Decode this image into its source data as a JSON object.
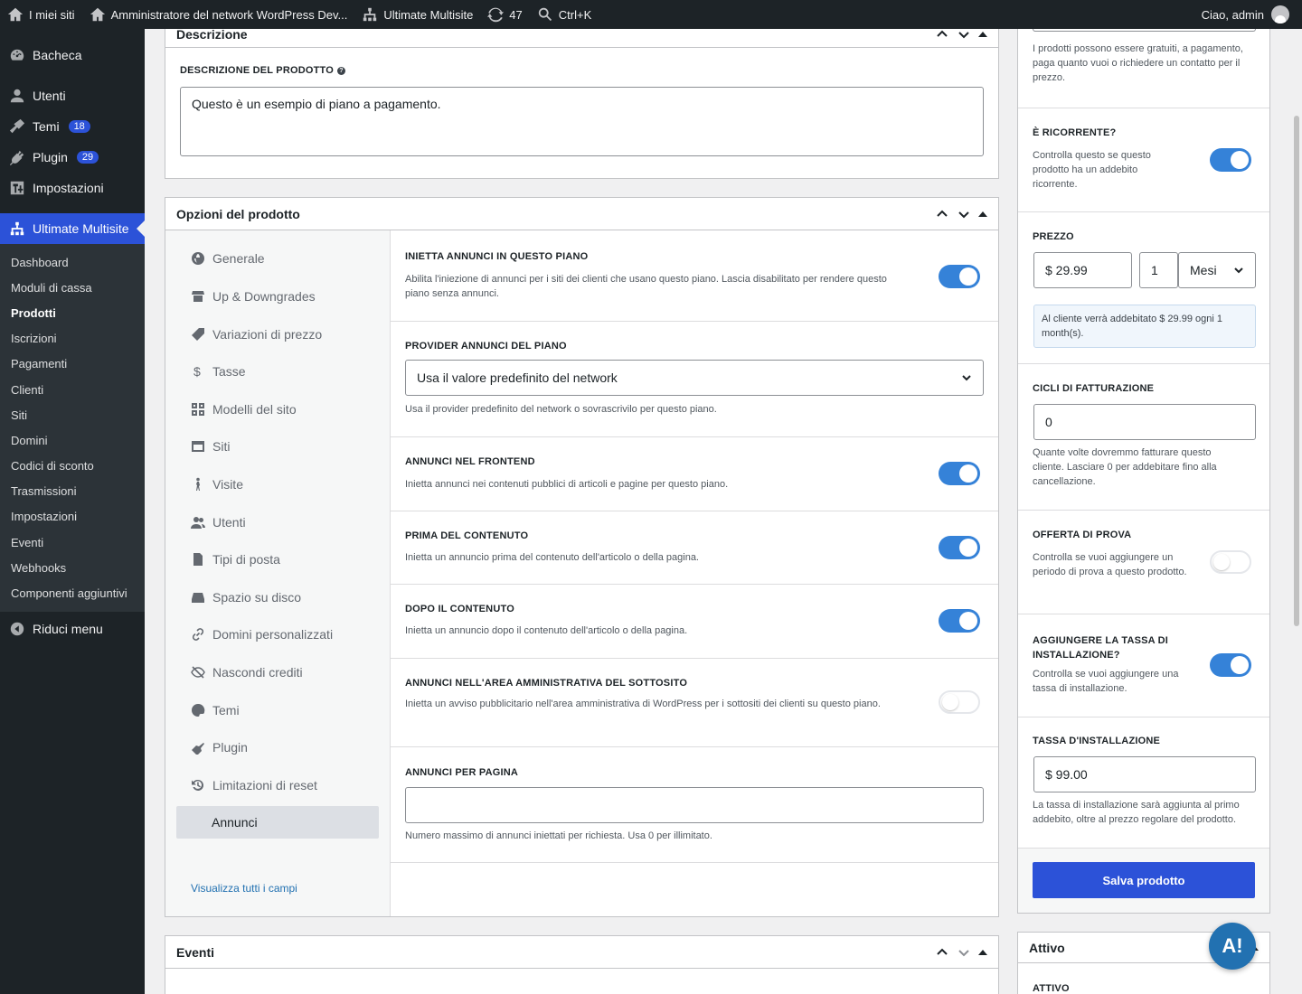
{
  "adminbar": {
    "my_sites": "I miei siti",
    "network_admin": "Amministratore del network WordPress Dev...",
    "ultimate_multisite": "Ultimate Multisite",
    "updates_count": "47",
    "search_shortcut": "Ctrl+K",
    "greeting": "Ciao, admin"
  },
  "sidebar": {
    "items": [
      {
        "label": "Bacheca",
        "icon": "dashboard-icon"
      },
      {
        "label": "Utenti",
        "icon": "users-icon"
      },
      {
        "label": "Temi",
        "icon": "themes-icon",
        "badge": "18"
      },
      {
        "label": "Plugin",
        "icon": "plugins-icon",
        "badge": "29"
      },
      {
        "label": "Impostazioni",
        "icon": "settings-icon"
      }
    ],
    "current": {
      "label": "Ultimate Multisite",
      "icon": "network-icon"
    },
    "submenu": [
      "Dashboard",
      "Moduli di cassa",
      "Prodotti",
      "Iscrizioni",
      "Pagamenti",
      "Clienti",
      "Siti",
      "Domini",
      "Codici di sconto",
      "Trasmissioni",
      "Impostazioni",
      "Eventi",
      "Webhooks",
      "Componenti aggiuntivi"
    ],
    "submenu_active": "Prodotti",
    "collapse": "Riduci menu"
  },
  "description_box": {
    "title": "Descrizione",
    "field_label": "DESCRIZIONE DEL PRODOTTO",
    "value": "Questo è un esempio di piano a pagamento."
  },
  "options_box": {
    "title": "Opzioni del prodotto",
    "nav": [
      {
        "label": "Generale",
        "icon": "globe-icon"
      },
      {
        "label": "Up & Downgrades",
        "icon": "store-icon"
      },
      {
        "label": "Variazioni di prezzo",
        "icon": "tag-icon"
      },
      {
        "label": "Tasse",
        "icon": "dollar-icon"
      },
      {
        "label": "Modelli del sito",
        "icon": "grid-icon"
      },
      {
        "label": "Siti",
        "icon": "browser-icon"
      },
      {
        "label": "Visite",
        "icon": "person-walk-icon"
      },
      {
        "label": "Utenti",
        "icon": "users-icon"
      },
      {
        "label": "Tipi di posta",
        "icon": "document-icon"
      },
      {
        "label": "Spazio su disco",
        "icon": "drive-icon"
      },
      {
        "label": "Domini personalizzati",
        "icon": "link-icon"
      },
      {
        "label": "Nascondi crediti",
        "icon": "eye-off-icon"
      },
      {
        "label": "Temi",
        "icon": "palette-icon"
      },
      {
        "label": "Plugin",
        "icon": "plug-icon"
      },
      {
        "label": "Limitazioni di reset",
        "icon": "history-icon"
      },
      {
        "label": "Annunci",
        "icon": ""
      }
    ],
    "view_all": "Visualizza tutti i campi",
    "rows": {
      "inject": {
        "label": "INIETTA ANNUNCI IN QUESTO PIANO",
        "desc": "Abilita l'iniezione di annunci per i siti dei clienti che usano questo piano. Lascia disabilitato per rendere questo piano senza annunci.",
        "on": true
      },
      "provider": {
        "label": "PROVIDER ANNUNCI DEL PIANO",
        "value": "Usa il valore predefinito del network",
        "desc": "Usa il provider predefinito del network o sovrascrivilo per questo piano."
      },
      "frontend": {
        "label": "ANNUNCI NEL FRONTEND",
        "desc": "Inietta annunci nei contenuti pubblici di articoli e pagine per questo piano.",
        "on": true
      },
      "before": {
        "label": "PRIMA DEL CONTENUTO",
        "desc": "Inietta un annuncio prima del contenuto dell'articolo o della pagina.",
        "on": true
      },
      "after": {
        "label": "DOPO IL CONTENUTO",
        "desc": "Inietta un annuncio dopo il contenuto dell'articolo o della pagina.",
        "on": true
      },
      "admin": {
        "label": "ANNUNCI NELL'AREA AMMINISTRATIVA DEL SOTTOSITO",
        "desc": "Inietta un avviso pubblicitario nell'area amministrativa di WordPress per i sottositi dei clienti su questo piano.",
        "on": false
      },
      "per_page": {
        "label": "ANNUNCI PER PAGINA",
        "value": "",
        "desc": "Numero massimo di annunci iniettati per richiesta. Usa 0 per illimitato."
      }
    }
  },
  "events_box": {
    "title": "Eventi"
  },
  "pricing": {
    "type_desc": "I prodotti possono essere gratuiti, a pagamento, paga quanto vuoi o richiedere un contatto per il prezzo.",
    "recurring": {
      "label": "È RICORRENTE?",
      "desc": "Controlla questo se questo prodotto ha un addebito ricorrente.",
      "on": true
    },
    "price": {
      "label": "PREZZO",
      "amount": "$ 29.99",
      "interval": "1",
      "unit": "Mesi",
      "note": "Al cliente verrà addebitato $ 29.99 ogni 1 month(s)."
    },
    "cycles": {
      "label": "CICLI DI FATTURAZIONE",
      "value": "0",
      "desc": "Quante volte dovremmo fatturare questo cliente. Lasciare 0 per addebitare fino alla cancellazione."
    },
    "trial": {
      "label": "OFFERTA DI PROVA",
      "desc": "Controlla se vuoi aggiungere un periodo di prova a questo prodotto.",
      "on": false
    },
    "setup_fee_toggle": {
      "label": "AGGIUNGERE LA TASSA DI INSTALLAZIONE?",
      "desc": "Controlla se vuoi aggiungere una tassa di installazione.",
      "on": true
    },
    "setup_fee": {
      "label": "TASSA D'INSTALLAZIONE",
      "value": "$ 99.00",
      "desc": "La tassa di installazione sarà aggiunta al primo addebito, oltre al prezzo regolare del prodotto."
    },
    "save": "Salva prodotto"
  },
  "active_box": {
    "title": "Attivo",
    "field_label": "ATTIVO"
  },
  "fab": {
    "label": "A!"
  },
  "colors": {
    "accent": "#2c52d8",
    "toggle_on": "#3582d8",
    "sidebar": "#1d2327"
  }
}
